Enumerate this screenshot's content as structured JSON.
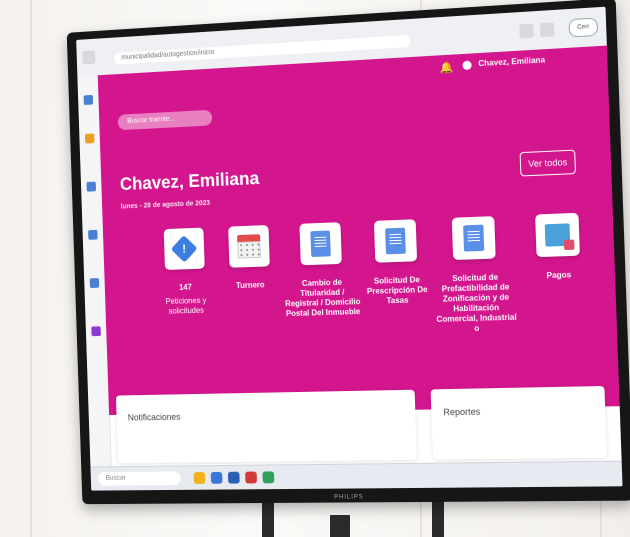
{
  "browser": {
    "url": "municipalidad/autogestion/inicio",
    "user_button": "Cerr"
  },
  "header": {
    "user_name": "Chavez, Emiliana"
  },
  "hero": {
    "search_placeholder": "Buscar tramite...",
    "greeting_name": "Chavez, Emiliana",
    "date": "lunes - 28 de agosto de 2023",
    "view_all_label": "Ver todos"
  },
  "tiles": [
    {
      "title": "147",
      "subtitle": "Peticiones y solicitudes",
      "icon": "alert-diamond-icon"
    },
    {
      "title": "Turnero",
      "subtitle": "",
      "icon": "calendar-icon"
    },
    {
      "title": "Cambio de Titularidad / Registral / Domicilio Postal Del Inmueble",
      "subtitle": "",
      "icon": "document-icon"
    },
    {
      "title": "Solicitud De Prescripción De Tasas",
      "subtitle": "",
      "icon": "document-icon"
    },
    {
      "title": "Solicitud de Prefactibilidad de Zonificación y de Habilitación Comercial, Industrial o",
      "subtitle": "",
      "icon": "document-icon"
    },
    {
      "title": "Pagos",
      "subtitle": "",
      "icon": "payment-icon"
    }
  ],
  "panels": {
    "notifications_title": "Notificaciones",
    "reports_title": "Reportes"
  },
  "taskbar": {
    "search_placeholder": "Buscar",
    "brand": "PHILIPS"
  },
  "colors": {
    "hero_magenta": "#d4168e",
    "accent_blue": "#3b7de0"
  }
}
